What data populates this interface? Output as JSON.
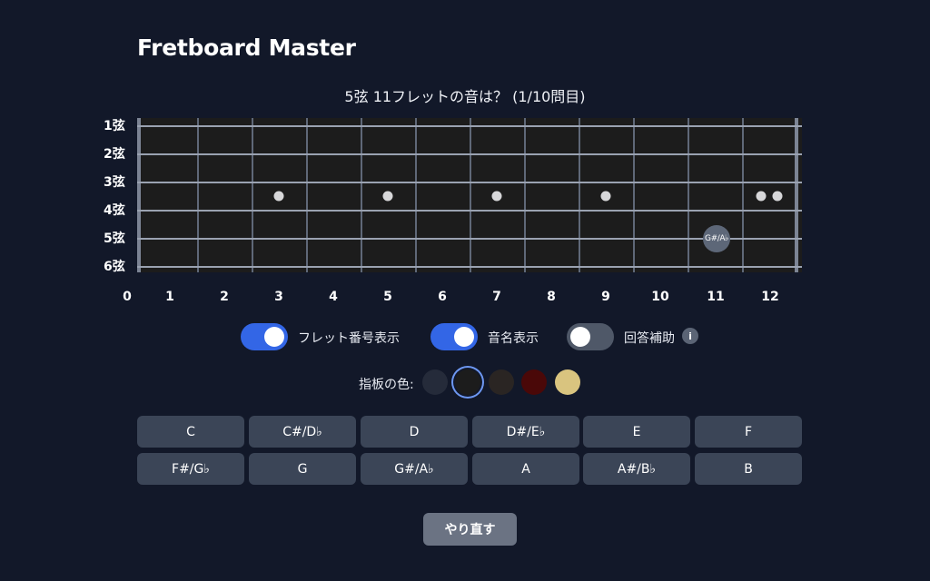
{
  "app": {
    "title": "Fretboard Master"
  },
  "quiz": {
    "question": "5弦 11フレットの音は？ (1/10問目)"
  },
  "fretboard": {
    "string_labels": [
      "1弦",
      "2弦",
      "3弦",
      "4弦",
      "5弦",
      "6弦"
    ],
    "fret_numbers": [
      "0",
      "1",
      "2",
      "3",
      "4",
      "5",
      "6",
      "7",
      "8",
      "9",
      "10",
      "11",
      "12"
    ],
    "target_note": {
      "string": 5,
      "fret": 11,
      "label": "G#/A♭"
    }
  },
  "toggles": [
    {
      "label": "フレット番号表示",
      "on": true
    },
    {
      "label": "音名表示",
      "on": true
    },
    {
      "label": "回答補助",
      "on": false,
      "info_icon": "i"
    }
  ],
  "board_color": {
    "label": "指板の色:",
    "options": [
      "#252b3a",
      "#1c1c1c",
      "#2a2523",
      "#4a0808",
      "#d9c47f"
    ],
    "selected_index": 1
  },
  "answers": [
    "C",
    "C#/D♭",
    "D",
    "D#/E♭",
    "E",
    "F",
    "F#/G♭",
    "G",
    "G#/A♭",
    "A",
    "A#/B♭",
    "B"
  ],
  "actions": {
    "retry_label": "やり直す"
  },
  "colors": {
    "accent": "#3366e6",
    "background": "#121829",
    "button": "#3b4557"
  }
}
